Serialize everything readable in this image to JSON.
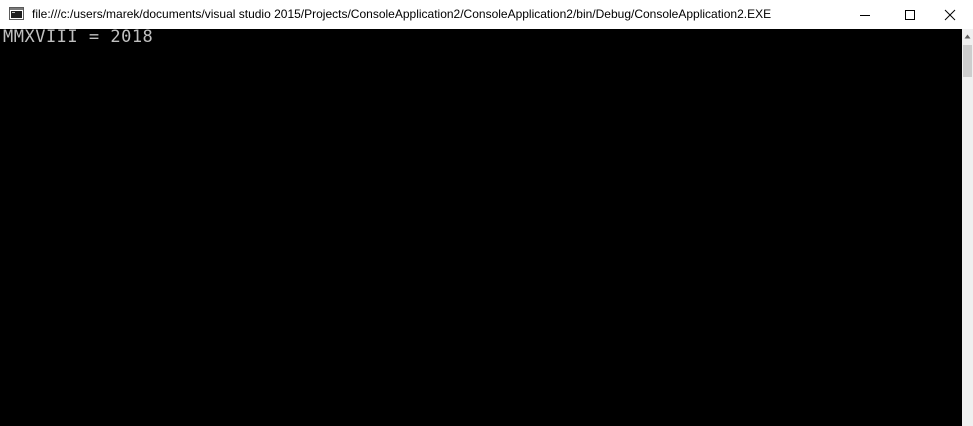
{
  "window": {
    "title": "file:///c:/users/marek/documents/visual studio 2015/Projects/ConsoleApplication2/ConsoleApplication2/bin/Debug/ConsoleApplication2.EXE"
  },
  "icons": {
    "app": "console-window-icon",
    "minimize": "minimize-icon",
    "maximize": "maximize-icon",
    "close": "close-icon",
    "scroll_up": "chevron-up-icon"
  },
  "console": {
    "lines": [
      "MMXVIII = 2018"
    ]
  },
  "colors": {
    "console_background": "#000000",
    "console_text": "#c0c0c0",
    "titlebar": "#ffffff"
  }
}
